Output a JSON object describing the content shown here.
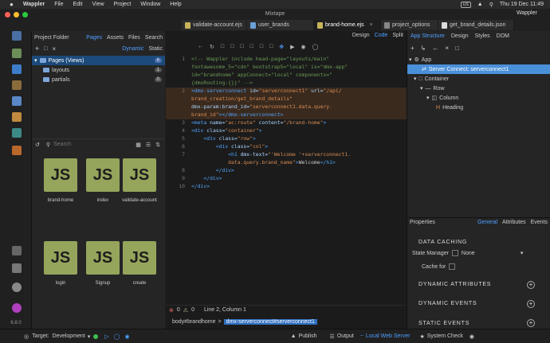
{
  "menubar": {
    "apple": "",
    "app": "Wappler",
    "items": [
      "File",
      "Edit",
      "View",
      "Project",
      "Window",
      "Help"
    ],
    "status_us": "US",
    "datetime": "Thu 19 Dec  11:49"
  },
  "window": {
    "title": "Mixtape"
  },
  "tabs": [
    {
      "label": "validate-account.ejs",
      "active": false
    },
    {
      "label": "user_brands",
      "active": false
    },
    {
      "label": "brand-home.ejs",
      "active": true
    },
    {
      "label": "project_options",
      "active": false
    },
    {
      "label": "get_brand_details.json",
      "active": false
    }
  ],
  "rightmark": "Wappler",
  "sidebar": {
    "version": "6.8.0"
  },
  "project": {
    "title": "Project Folder",
    "links": [
      "Pages",
      "Assets",
      "Files",
      "Search"
    ],
    "modes": [
      "Dynamic",
      "Static"
    ],
    "tree": [
      {
        "label": "Pages (Views)",
        "count": "6"
      },
      {
        "label": "layouts",
        "count": "1"
      },
      {
        "label": "partials",
        "count": "0"
      }
    ],
    "search_placeholder": "Search",
    "files": [
      {
        "name": "brand-home",
        "icon": "JS"
      },
      {
        "name": "index",
        "icon": "JS"
      },
      {
        "name": "validate-account",
        "icon": "JS"
      },
      {
        "name": "login",
        "icon": "JS"
      },
      {
        "name": "Signup",
        "icon": "JS"
      },
      {
        "name": "create",
        "icon": "JS"
      }
    ]
  },
  "editor": {
    "modes": [
      "Design",
      "Code",
      "Split"
    ],
    "active_mode": "Code",
    "lines": [
      {
        "n": "1",
        "parts": [
          {
            "c": "cm",
            "t": "<!-- Wappler include head-page=\"layouts/main\""
          }
        ]
      },
      {
        "n": "",
        "parts": [
          {
            "c": "cm",
            "t": "fontawesome_5=\"cdn\" bootstrap5=\"local\" is=\"dmx-app\""
          }
        ]
      },
      {
        "n": "",
        "parts": [
          {
            "c": "cm",
            "t": "id=\"brandhome\" appConnect=\"local\" components=\""
          }
        ]
      },
      {
        "n": "",
        "parts": [
          {
            "c": "cm",
            "t": "{dmxRouting:{}}\" -->"
          }
        ]
      },
      {
        "n": "2",
        "hl": true,
        "parts": [
          {
            "c": "tg",
            "t": "<dmx-serverconnect "
          },
          {
            "c": "at",
            "t": "id="
          },
          {
            "c": "st",
            "t": "\"serverconnect1\" "
          },
          {
            "c": "at",
            "t": "url="
          },
          {
            "c": "st",
            "t": "\"/api/"
          }
        ]
      },
      {
        "n": "",
        "hl": true,
        "parts": [
          {
            "c": "st",
            "t": "brand_creation/get_brand_details\""
          }
        ]
      },
      {
        "n": "",
        "hl": true,
        "parts": [
          {
            "c": "at",
            "t": "dmx-param:brand_id="
          },
          {
            "c": "st",
            "t": "\"serverconnect1.data.query."
          }
        ]
      },
      {
        "n": "",
        "hl": true,
        "parts": [
          {
            "c": "st",
            "t": "brand_id\""
          },
          {
            "c": "tg",
            "t": "></dmx-serverconnect>"
          }
        ]
      },
      {
        "n": "3",
        "parts": [
          {
            "c": "tg",
            "t": "<meta "
          },
          {
            "c": "at",
            "t": "name="
          },
          {
            "c": "st",
            "t": "\"ac:route\" "
          },
          {
            "c": "at",
            "t": "content="
          },
          {
            "c": "st",
            "t": "\"/brand-home\""
          },
          {
            "c": "tg",
            "t": ">"
          }
        ]
      },
      {
        "n": "4",
        "parts": [
          {
            "c": "tg",
            "t": "<div "
          },
          {
            "c": "at",
            "t": "class="
          },
          {
            "c": "st",
            "t": "\"container\""
          },
          {
            "c": "tg",
            "t": ">"
          }
        ]
      },
      {
        "n": "5",
        "parts": [
          {
            "c": "tg",
            "t": "    <div "
          },
          {
            "c": "at",
            "t": "class="
          },
          {
            "c": "st",
            "t": "\"row\""
          },
          {
            "c": "tg",
            "t": ">"
          }
        ]
      },
      {
        "n": "6",
        "parts": [
          {
            "c": "tg",
            "t": "        <div "
          },
          {
            "c": "at",
            "t": "class="
          },
          {
            "c": "st",
            "t": "\"col\""
          },
          {
            "c": "tg",
            "t": ">"
          }
        ]
      },
      {
        "n": "7",
        "parts": [
          {
            "c": "tg",
            "t": "            <h1 "
          },
          {
            "c": "at",
            "t": "dmx-text="
          },
          {
            "c": "st",
            "t": "\"'Welcome '+serverconnect1."
          }
        ]
      },
      {
        "n": "",
        "parts": [
          {
            "c": "st",
            "t": "            data.query.brand_name\""
          },
          {
            "c": "tg",
            "t": ">"
          },
          {
            "c": "code",
            "t": "Welcome"
          },
          {
            "c": "tg",
            "t": "</h1>"
          }
        ]
      },
      {
        "n": "8",
        "parts": [
          {
            "c": "tg",
            "t": "        </div>"
          }
        ]
      },
      {
        "n": "9",
        "parts": [
          {
            "c": "tg",
            "t": "    </div>"
          }
        ]
      },
      {
        "n": "10",
        "parts": [
          {
            "c": "tg",
            "t": "</div>"
          }
        ]
      }
    ],
    "errors": "0",
    "warnings": "0",
    "position": "Line 2, Column 1",
    "breadcrumb": "body#brandhome",
    "breadcrumb_active": "dmx-serverconnect#serverconnect1"
  },
  "structure": {
    "tabs": [
      "App Structure",
      "Design",
      "Styles",
      "DOM"
    ],
    "tree": [
      {
        "label": "App",
        "depth": 0
      },
      {
        "label": "Server Connect: serverconnect1",
        "depth": 1,
        "selected": true
      },
      {
        "label": "Container",
        "depth": 1
      },
      {
        "label": "Row",
        "depth": 2
      },
      {
        "label": "Column",
        "depth": 3
      },
      {
        "label": "Heading",
        "depth": 4
      }
    ]
  },
  "properties": {
    "title": "Properties",
    "tabs": [
      "General",
      "Attributes",
      "Events"
    ],
    "sections": [
      "DATA CACHING",
      "DYNAMIC ATTRIBUTES",
      "DYNAMIC EVENTS",
      "STATIC EVENTS"
    ],
    "state_manager_label": "State Manager",
    "state_manager_value": "None",
    "cache_for_label": "Cache for"
  },
  "statusbar": {
    "target_label": "Target:",
    "target_value": "Development",
    "publish": "Publish",
    "output": "Output",
    "server": "Local Web Server",
    "system_check": "System Check"
  }
}
